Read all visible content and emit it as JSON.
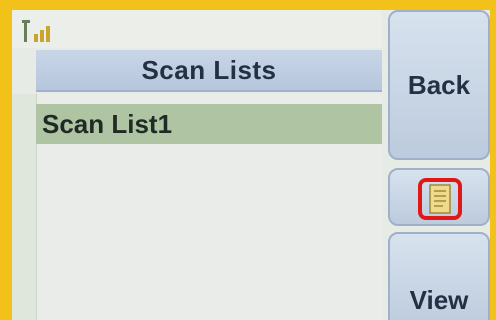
{
  "title": "Scan Lists",
  "list": {
    "items": [
      {
        "label": "Scan List1",
        "selected": true
      }
    ]
  },
  "softkeys": {
    "back_label": "Back",
    "view_label": "View",
    "middle_icon": "document-icon"
  },
  "status": {
    "signal_icon": "signal-strength-icon"
  },
  "colors": {
    "frame": "#f2c21a",
    "title_bar": "#c9d6e8",
    "selected_item": "#aec4a3",
    "highlight_border": "#e01818"
  }
}
